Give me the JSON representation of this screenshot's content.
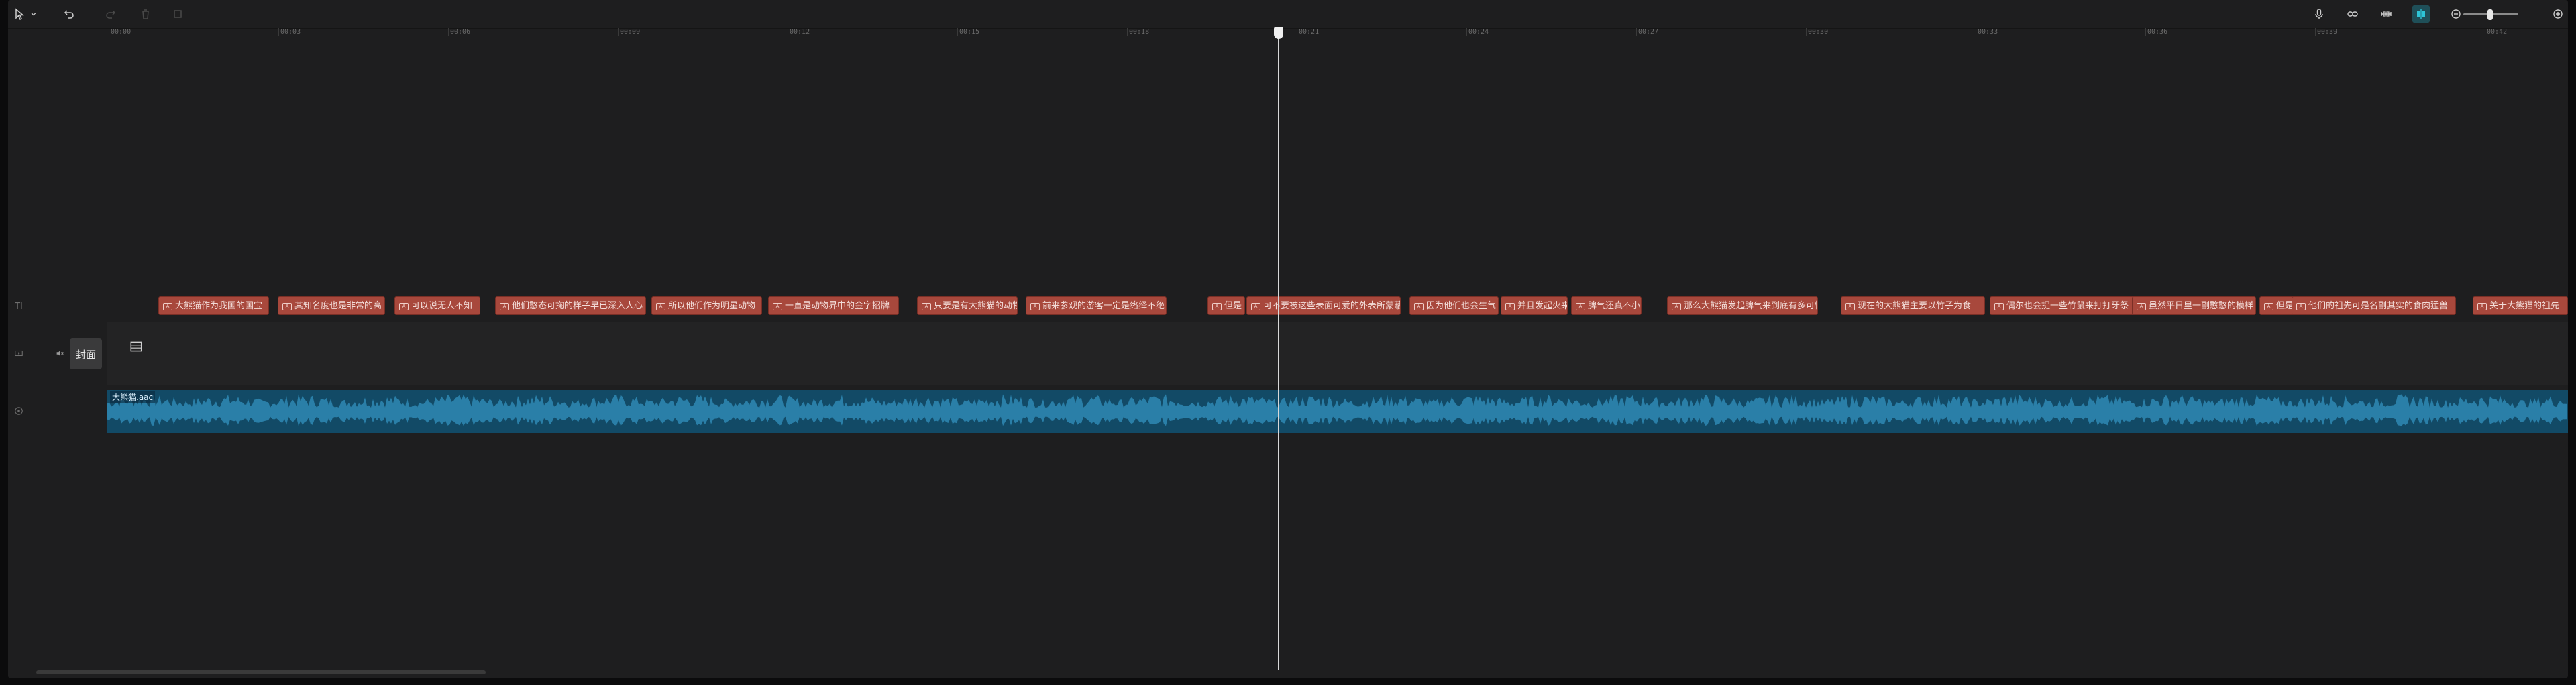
{
  "app": {
    "accent_color": "#2ec4d6",
    "subtitle_clip_color": "#a8483c",
    "audio_track_color": "#124a66"
  },
  "toolbar": {
    "left_icons": [
      "select-pointer-icon",
      "dropdown-chevron-icon",
      "undo-icon",
      "redo-icon",
      "delete-icon",
      "crop-icon"
    ],
    "right_icons": [
      "microphone-icon",
      "link-icon",
      "preview-axis-icon",
      "magnet-snap-icon",
      "zoom-out-icon",
      "zoom-in-icon"
    ],
    "zoom_level": 0.45
  },
  "ruler": {
    "ticks": [
      "00:00",
      "00:03",
      "00:06",
      "00:09",
      "00:12",
      "00:15",
      "00:18",
      "00:21",
      "00:24",
      "00:27",
      "00:30",
      "00:33",
      "00:36",
      "00:39",
      "00:42"
    ]
  },
  "playhead_time": "00:20.8",
  "tracks": {
    "text_icon": "TI",
    "subtitle_clips": [
      {
        "label": "大熊猫作为我国的国宝"
      },
      {
        "label": "其知名度也是非常的高"
      },
      {
        "label": "可以说无人不知"
      },
      {
        "label": "他们憨态可掬的样子早已深入人心"
      },
      {
        "label": "所以他们作为明星动物"
      },
      {
        "label": "一直是动物界中的金字招牌"
      },
      {
        "label": "只要是有大熊猫的动物"
      },
      {
        "label": "前来参观的游客一定是络绎不绝"
      },
      {
        "label": "但是"
      },
      {
        "label": "可不要被这些表面可爱的外表所蒙蔽"
      },
      {
        "label": "因为他们也会生气"
      },
      {
        "label": "并且发起火来"
      },
      {
        "label": "脾气还真不小"
      },
      {
        "label": "那么大熊猫发起脾气来到底有多可怕"
      },
      {
        "label": "现在的大熊猫主要以竹子为食"
      },
      {
        "label": "偶尔也会捉一些竹鼠来打打牙祭"
      },
      {
        "label": "虽然平日里一副憨憨的模样"
      },
      {
        "label": "但是"
      },
      {
        "label": "他们的祖先可是名副其实的食肉猛兽"
      },
      {
        "label": "关于大熊猫的祖先"
      }
    ],
    "main_track_cover_label": "封面",
    "audio_clip_label": "大熊猫.aac"
  }
}
